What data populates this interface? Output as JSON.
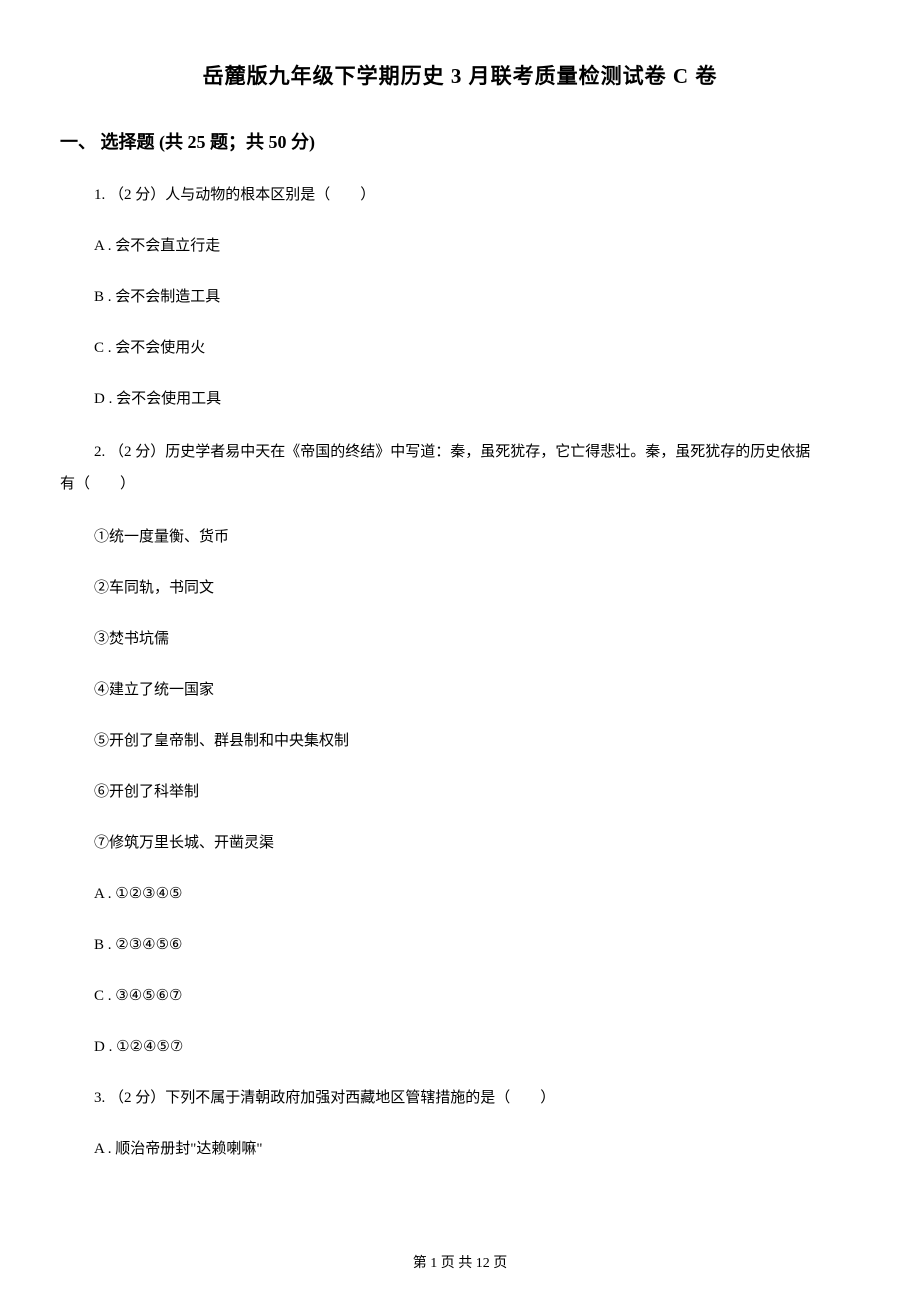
{
  "title": "岳麓版九年级下学期历史 3 月联考质量检测试卷 C 卷",
  "section": {
    "label": "一、 选择题 (共 25 题；共 50 分)"
  },
  "q1": {
    "stem": "1. （2 分）人与动物的根本区别是（　　）",
    "A": "A . 会不会直立行走",
    "B": "B . 会不会制造工具",
    "C": "C . 会不会使用火",
    "D": "D . 会不会使用工具"
  },
  "q2": {
    "line1": "2. （2 分）历史学者易中天在《帝国的终结》中写道：秦，虽死犹存，它亡得悲壮。秦，虽死犹存的历史依据",
    "line2": "有（　　）",
    "items": {
      "i1": "①统一度量衡、货币",
      "i2": "②车同轨，书同文",
      "i3": "③焚书坑儒",
      "i4": "④建立了统一国家",
      "i5": "⑤开创了皇帝制、群县制和中央集权制",
      "i6": "⑥开创了科举制",
      "i7": "⑦修筑万里长城、开凿灵渠"
    },
    "A": "A . ①②③④⑤",
    "B": "B . ②③④⑤⑥",
    "C": "C . ③④⑤⑥⑦",
    "D": "D . ①②④⑤⑦"
  },
  "q3": {
    "stem": "3. （2 分）下列不属于清朝政府加强对西藏地区管辖措施的是（　　）",
    "A": "A . 顺治帝册封\"达赖喇嘛\""
  },
  "footer": "第 1 页 共 12 页"
}
